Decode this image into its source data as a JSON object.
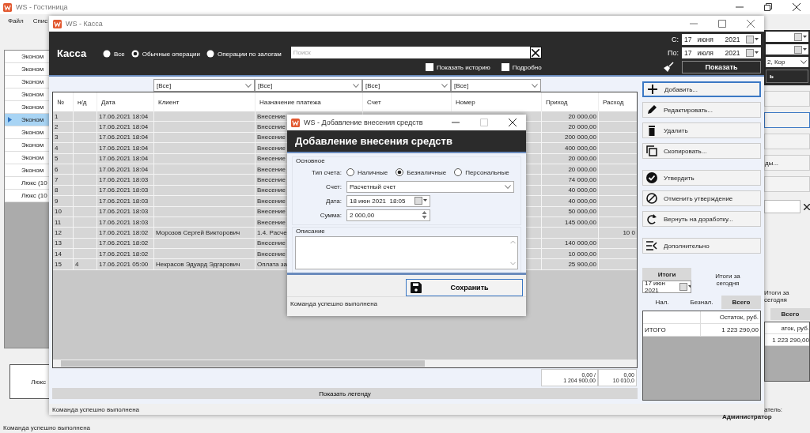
{
  "main_window": {
    "title": "WS - Гостиница",
    "menu": [
      "Файл",
      "Спис"
    ],
    "rooms": [
      {
        "label": "Эконом",
        "selected": false
      },
      {
        "label": "Эконом",
        "selected": false
      },
      {
        "label": "Эконом",
        "selected": false
      },
      {
        "label": "Эконом",
        "selected": false
      },
      {
        "label": "Эконом",
        "selected": false
      },
      {
        "label": "Эконом",
        "selected": true
      },
      {
        "label": "Эконом",
        "selected": false
      },
      {
        "label": "Эконом",
        "selected": false
      },
      {
        "label": "Эконом",
        "selected": false
      },
      {
        "label": "Эконом",
        "selected": false
      },
      {
        "label": "Люкс (10",
        "selected": false
      },
      {
        "label": "Люкс (10",
        "selected": false
      }
    ],
    "room_box": "Люкс",
    "side": {
      "dropdown": "2, Кор",
      "dark_button": "ь",
      "partial_button": "ды...",
      "today_label": "Итоги за сегодня",
      "tab": "Всего",
      "column": "аток, руб.",
      "value": "1 223 290,00",
      "user_label": "атель:",
      "user": "Администратор"
    },
    "status_bar": "Команда успешно выполнена"
  },
  "cash_window": {
    "title": "WS - Касса",
    "heading": "Касса",
    "modes": [
      {
        "label": "Все",
        "selected": false
      },
      {
        "label": "Обычные операции",
        "selected": true
      },
      {
        "label": "Операции по залогам",
        "selected": false
      }
    ],
    "search": {
      "placeholder": "Поиск"
    },
    "options": [
      {
        "label": "Показать историю",
        "checked": false
      },
      {
        "label": "Подробно",
        "checked": false
      }
    ],
    "period": [
      {
        "label": "С:",
        "day": "17",
        "month": "июня",
        "year": "2021"
      },
      {
        "label": "По:",
        "day": "17",
        "month": "июля",
        "year": "2021"
      }
    ],
    "show_button": "Показать",
    "columns": [
      {
        "label": "№"
      },
      {
        "label": "н/д"
      },
      {
        "label": "Дата"
      },
      {
        "label": "Клиент",
        "filter": "[Все]"
      },
      {
        "label": "Назначение платежа",
        "filter": "[Все]"
      },
      {
        "label": "Счет",
        "filter": "[Все]"
      },
      {
        "label": "Номер",
        "filter": "[Все]"
      },
      {
        "label": "Приход"
      },
      {
        "label": "Расход"
      }
    ],
    "rows": [
      {
        "no": "1",
        "date": "17.06.2021 18:04",
        "purpose": "Внесение",
        "income": "20 000,00"
      },
      {
        "no": "2",
        "date": "17.06.2021 18:04",
        "purpose": "Внесение",
        "income": "20 000,00"
      },
      {
        "no": "3",
        "date": "17.06.2021 18:04",
        "purpose": "Внесение",
        "income": "200 000,00"
      },
      {
        "no": "4",
        "date": "17.06.2021 18:04",
        "purpose": "Внесение",
        "income": "400 000,00"
      },
      {
        "no": "5",
        "date": "17.06.2021 18:04",
        "purpose": "Внесение",
        "income": "20 000,00"
      },
      {
        "no": "6",
        "date": "17.06.2021 18:04",
        "purpose": "Внесение",
        "income": "20 000,00"
      },
      {
        "no": "7",
        "date": "17.06.2021 18:03",
        "purpose": "Внесение",
        "income": "74 000,00"
      },
      {
        "no": "8",
        "date": "17.06.2021 18:03",
        "purpose": "Внесение",
        "income": "40 000,00"
      },
      {
        "no": "9",
        "date": "17.06.2021 18:03",
        "purpose": "Внесение",
        "income": "40 000,00"
      },
      {
        "no": "10",
        "date": "17.06.2021 18:03",
        "purpose": "Внесение",
        "income": "50 000,00"
      },
      {
        "no": "11",
        "date": "17.06.2021 18:03",
        "purpose": "Внесение",
        "income": "145 000,00"
      },
      {
        "no": "12",
        "date": "17.06.2021 18:02",
        "client": "Морозов Сергей Викторович",
        "purpose": "1.4. Расче",
        "expense": "10 0"
      },
      {
        "no": "13",
        "date": "17.06.2021 18:02",
        "purpose": "Внесение",
        "income": "140 000,00"
      },
      {
        "no": "14",
        "date": "17.06.2021 18:02",
        "purpose": "Внесение",
        "income": "10 000,00"
      },
      {
        "no": "15",
        "nd": "4",
        "date": "17.06.2021 05:00",
        "client": "Некрасов Эдуард Эдгарович",
        "purpose": "Оплата за",
        "income": "25 900,00"
      }
    ],
    "totals": [
      [
        "0,00 /",
        "1 204 900,00"
      ],
      [
        "0,00",
        "10 010,0"
      ]
    ],
    "legend_button": "Показать легенду",
    "action_groups": [
      [
        {
          "label": "Добавить...",
          "focused": true
        },
        {
          "label": "Редактировать...",
          "focused": false
        },
        {
          "label": "Удалить",
          "focused": false
        },
        {
          "label": "Скопировать...",
          "focused": false
        }
      ],
      [
        {
          "label": "Утвердить",
          "focused": false
        },
        {
          "label": "Отменить утверждение",
          "focused": false
        },
        {
          "label": "Вернуть на доработку...",
          "focused": false
        }
      ],
      [
        {
          "label": "Дополнительно",
          "focused": false
        }
      ]
    ],
    "summary": {
      "tab": "Итоги",
      "date": "17 июн 2021",
      "today_label": "Итоги за сегодня",
      "tabs": [
        {
          "label": "Нал.",
          "selected": false
        },
        {
          "label": "Безнал.",
          "selected": false
        },
        {
          "label": "Всего",
          "selected": true
        }
      ],
      "column": "Остаток, руб.",
      "rows": [
        {
          "label": "ИТОГО",
          "value": "1 223 290,00"
        }
      ]
    },
    "status_bar": "Команда успешно выполнена"
  },
  "dialog": {
    "title": "WS - Добавление внесения средств",
    "heading": "Добавление внесения средств",
    "group": "Основное",
    "type_label": "Тип счета:",
    "types": [
      {
        "label": "Наличные",
        "selected": false
      },
      {
        "label": "Безналичные",
        "selected": true
      },
      {
        "label": "Персональные",
        "selected": false
      }
    ],
    "account_label": "Счет:",
    "account": "Расчетный счет",
    "date_label": "Дата:",
    "date": "18 июн 2021  18:05",
    "sum_label": "Сумма:",
    "sum": "2 000,00",
    "description_label": "Описание",
    "save_button": "Сохранить",
    "status_bar": "Команда успешно выполнена"
  }
}
